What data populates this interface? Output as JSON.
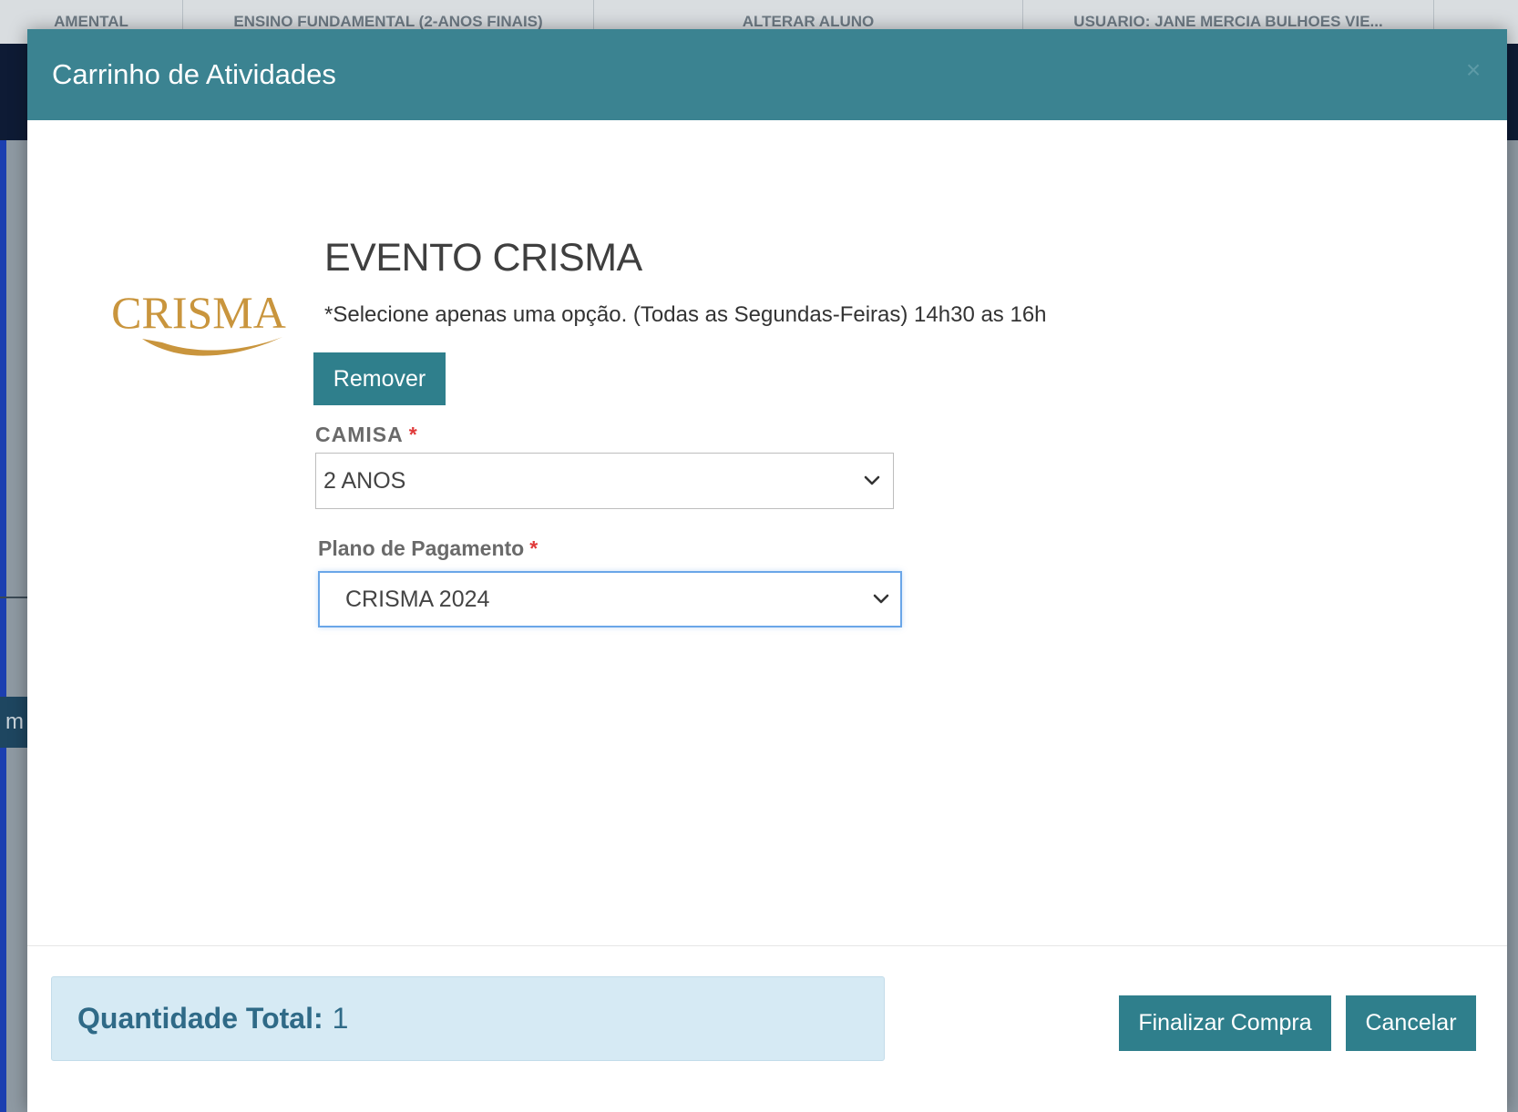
{
  "background": {
    "topbar": [
      "AMENTAL",
      "ENSINO FUNDAMENTAL (2-ANOS FINAIS)",
      "ALTERAR ALUNO",
      "USUARIO: JANE MERCIA BULHOES VIE..."
    ],
    "fragment": "m"
  },
  "modal": {
    "title": "Carrinho de Atividades",
    "close_glyph": "×"
  },
  "event": {
    "logo_text": "CRISMA",
    "title": "EVENTO CRISMA",
    "description": "*Selecione apenas uma opção. (Todas as Segundas-Feiras) 14h30 as 16h",
    "remove_label": "Remover"
  },
  "form": {
    "camisa": {
      "label": "CAMISA",
      "required_mark": "*",
      "selected": "2 ANOS"
    },
    "plano": {
      "label": "Plano de Pagamento",
      "required_mark": "*",
      "selected": "CRISMA 2024"
    }
  },
  "footer": {
    "total_label": "Quantidade Total:",
    "total_value": "1",
    "finalize_label": "Finalizar Compra",
    "cancel_label": "Cancelar"
  },
  "colors": {
    "header": "#3b8391",
    "button": "#2f7f8c",
    "logo_gold": "#c9953d",
    "total_bg": "#d6eaf4",
    "total_text": "#2f6a87",
    "required": "#e03a3a"
  }
}
